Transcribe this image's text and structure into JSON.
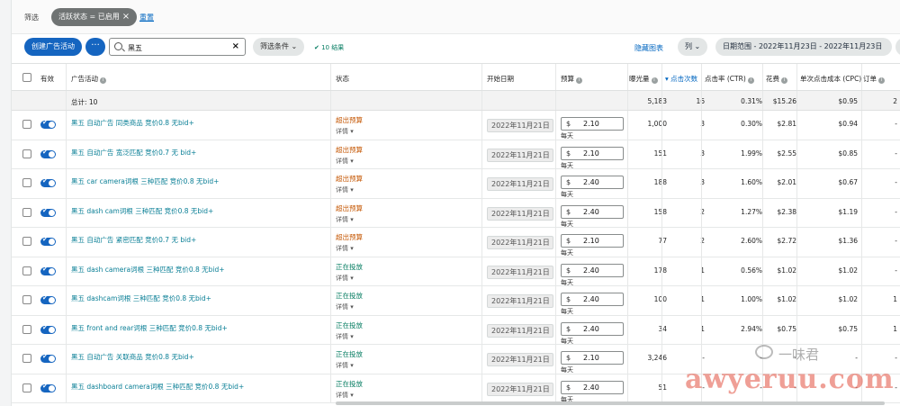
{
  "filterbar": {
    "label": "筛选",
    "chip_label": "活跃状态 = 已启用",
    "chip_close": "×",
    "reset": "重置"
  },
  "toolbar": {
    "create_button": "创建广告活动",
    "more_button": "···",
    "search_value": "黑五",
    "search_clear": "×",
    "filter_button": "筛选条件 ⌄",
    "results": "✔ 10 结果",
    "hide_chart": "隐藏图表",
    "columns_button": "列 ⌄",
    "date_range": "日期范围 - 2022年11月23日 - 2022年11月23日"
  },
  "columns": {
    "active": "有效",
    "campaign": "广告活动",
    "status": "状态",
    "start_date": "开始日期",
    "budget": "预算",
    "impressions": "曝光量",
    "clicks": "▾ 点击次数",
    "ctr": "点击率 (CTR)",
    "spend": "花费",
    "cpc": "单次点击成本 (CPC)",
    "orders": "订单"
  },
  "summary": {
    "label": "总计: 10",
    "impressions": "5,183",
    "clicks": "16",
    "ctr": "0.31%",
    "spend": "$15.26",
    "cpc": "$0.95",
    "orders": "2"
  },
  "rows": [
    {
      "campaign": "黑五 自动广告 同类商品 竞价0.8 无bid+",
      "status": "超出预算",
      "status_kind": "over",
      "detail": "详情 ▾",
      "start_date": "2022年11月21日",
      "currency": "$",
      "budget": "2.10",
      "per": "每天",
      "impressions": "1,000",
      "clicks": "3",
      "ctr": "0.30%",
      "spend": "$2.81",
      "cpc": "$0.94",
      "orders": "-"
    },
    {
      "campaign": "黑五 自动广告 宽泛匹配 竞价0.7 无 bid+",
      "status": "超出预算",
      "status_kind": "over",
      "detail": "详情 ▾",
      "start_date": "2022年11月21日",
      "currency": "$",
      "budget": "2.10",
      "per": "每天",
      "impressions": "151",
      "clicks": "3",
      "ctr": "1.99%",
      "spend": "$2.55",
      "cpc": "$0.85",
      "orders": "-"
    },
    {
      "campaign": "黑五 car camera词根 三种匹配 竞价0.8 无bid+",
      "status": "超出预算",
      "status_kind": "over",
      "detail": "详情 ▾",
      "start_date": "2022年11月21日",
      "currency": "$",
      "budget": "2.40",
      "per": "每天",
      "impressions": "188",
      "clicks": "3",
      "ctr": "1.60%",
      "spend": "$2.01",
      "cpc": "$0.67",
      "orders": "-"
    },
    {
      "campaign": "黑五 dash cam词根 三种匹配 竞价0.8 无bid+",
      "status": "超出预算",
      "status_kind": "over",
      "detail": "详情 ▾",
      "start_date": "2022年11月21日",
      "currency": "$",
      "budget": "2.40",
      "per": "每天",
      "impressions": "158",
      "clicks": "2",
      "ctr": "1.27%",
      "spend": "$2.38",
      "cpc": "$1.19",
      "orders": "-"
    },
    {
      "campaign": "黑五 自动广告 紧密匹配 竞价0.7 无 bid+",
      "status": "超出预算",
      "status_kind": "over",
      "detail": "详情 ▾",
      "start_date": "2022年11月21日",
      "currency": "$",
      "budget": "2.10",
      "per": "每天",
      "impressions": "77",
      "clicks": "2",
      "ctr": "2.60%",
      "spend": "$2.72",
      "cpc": "$1.36",
      "orders": "-"
    },
    {
      "campaign": "黑五 dash camera词根 三种匹配 竞价0.8 无bid+",
      "status": "正在投放",
      "status_kind": "live",
      "detail": "详情 ▾",
      "start_date": "2022年11月21日",
      "currency": "$",
      "budget": "2.40",
      "per": "每天",
      "impressions": "178",
      "clicks": "1",
      "ctr": "0.56%",
      "spend": "$1.02",
      "cpc": "$1.02",
      "orders": "-"
    },
    {
      "campaign": "黑五 dashcam词根 三种匹配 竞价0.8 无bid+",
      "status": "正在投放",
      "status_kind": "live",
      "detail": "详情 ▾",
      "start_date": "2022年11月21日",
      "currency": "$",
      "budget": "2.40",
      "per": "每天",
      "impressions": "100",
      "clicks": "1",
      "ctr": "1.00%",
      "spend": "$1.02",
      "cpc": "$1.02",
      "orders": "1"
    },
    {
      "campaign": "黑五 front and rear词根 三种匹配 竞价0.8 无bid+",
      "status": "正在投放",
      "status_kind": "live",
      "detail": "详情 ▾",
      "start_date": "2022年11月21日",
      "currency": "$",
      "budget": "2.40",
      "per": "每天",
      "impressions": "34",
      "clicks": "1",
      "ctr": "2.94%",
      "spend": "$0.75",
      "cpc": "$0.75",
      "orders": "1"
    },
    {
      "campaign": "黑五 自动广告 关联商品 竞价0.8 无bid+",
      "status": "正在投放",
      "status_kind": "live",
      "detail": "详情 ▾",
      "start_date": "2022年11月21日",
      "currency": "$",
      "budget": "2.10",
      "per": "每天",
      "impressions": "3,246",
      "clicks": "-",
      "ctr": "-",
      "spend": "-",
      "cpc": "-",
      "orders": "-"
    },
    {
      "campaign": "黑五 dashboard camera词根 三种匹配 竞价0.8 无bid+",
      "status": "正在投放",
      "status_kind": "live",
      "detail": "详情 ▾",
      "start_date": "2022年11月21日",
      "currency": "$",
      "budget": "2.40",
      "per": "每天",
      "impressions": "51",
      "clicks": "-",
      "ctr": "-",
      "spend": "-",
      "cpc": "-",
      "orders": "-"
    }
  ],
  "watermark": {
    "text": "awyeruu.com",
    "brand": "一味君"
  },
  "colors": {
    "primary": "#1565c0",
    "over_budget": "#c45500",
    "live": "#067d62",
    "link": "#0a7f96"
  }
}
